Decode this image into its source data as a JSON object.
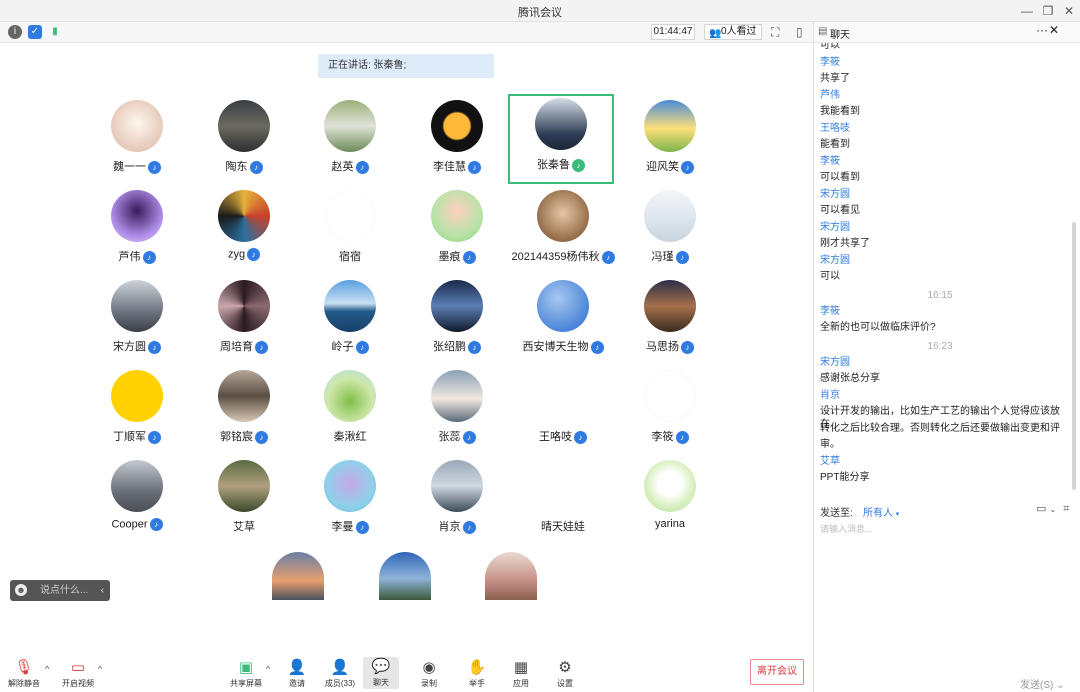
{
  "window": {
    "title": "腾讯会议"
  },
  "topbar": {
    "timer": "01:44:47",
    "viewers": "0人看过"
  },
  "speaking": "正在讲话: 张秦鲁;",
  "participants": [
    {
      "name": "魏一一"
    },
    {
      "name": "陶东"
    },
    {
      "name": "赵英"
    },
    {
      "name": "李佳慧"
    },
    {
      "name": "张秦鲁"
    },
    {
      "name": "迎风笑"
    },
    {
      "name": "芦伟"
    },
    {
      "name": "zyg"
    },
    {
      "name": "宿宿"
    },
    {
      "name": "墨痕"
    },
    {
      "name": "202144359杨伟秋"
    },
    {
      "name": "冯瑾"
    },
    {
      "name": "宋方圆"
    },
    {
      "name": "周培育"
    },
    {
      "name": "岭子"
    },
    {
      "name": "张绍鹏"
    },
    {
      "name": "西安博天生物"
    },
    {
      "name": "马思扬"
    },
    {
      "name": "丁顺军"
    },
    {
      "name": "郭铭宸"
    },
    {
      "name": "秦湫红"
    },
    {
      "name": "张蕊"
    },
    {
      "name": "王咯吱"
    },
    {
      "name": "李筱"
    },
    {
      "name": "Cooper"
    },
    {
      "name": "艾草"
    },
    {
      "name": "李曼"
    },
    {
      "name": "肖京"
    },
    {
      "name": "晴天娃娃"
    },
    {
      "name": "yarina"
    }
  ],
  "saybox": {
    "placeholder": "说点什么..."
  },
  "bottombar": {
    "unmute": "解除静音",
    "video": "开启视频",
    "share": "共享屏幕",
    "invite": "邀请",
    "members": "成员(33)",
    "chat": "聊天",
    "record": "录制",
    "hand": "举手",
    "apps": "应用",
    "settings": "设置",
    "leave": "离开会议"
  },
  "chat": {
    "title": "聊天",
    "messages": [
      {
        "kind": "m",
        "text": "可以"
      },
      {
        "kind": "s",
        "text": "李筱"
      },
      {
        "kind": "m",
        "text": "共享了"
      },
      {
        "kind": "s",
        "text": "芦伟"
      },
      {
        "kind": "m",
        "text": "我能看到"
      },
      {
        "kind": "s",
        "text": "王咯吱"
      },
      {
        "kind": "m",
        "text": "能看到"
      },
      {
        "kind": "s",
        "text": "李筱"
      },
      {
        "kind": "m",
        "text": "可以看到"
      },
      {
        "kind": "s",
        "text": "宋方圆"
      },
      {
        "kind": "m",
        "text": "可以看见"
      },
      {
        "kind": "s",
        "text": "宋方圆"
      },
      {
        "kind": "m",
        "text": "刚才共享了"
      },
      {
        "kind": "s",
        "text": "宋方圆"
      },
      {
        "kind": "m",
        "text": "可以"
      },
      {
        "kind": "time",
        "text": "16:15"
      },
      {
        "kind": "s",
        "text": "李筱"
      },
      {
        "kind": "m",
        "text": "全新的也可以做临床评价?"
      },
      {
        "kind": "time",
        "text": "16:23"
      },
      {
        "kind": "s",
        "text": "宋方圆"
      },
      {
        "kind": "m",
        "text": "感谢张总分享"
      },
      {
        "kind": "s",
        "text": "肖京"
      },
      {
        "kind": "m",
        "text": "设计开发的输出，比如生产工艺的输出个人觉得应该放在"
      },
      {
        "kind": "m",
        "text": "转化之后比较合理。否则转化之后还要做输出变更和评"
      },
      {
        "kind": "m",
        "text": "审。"
      },
      {
        "kind": "s",
        "text": "艾草"
      },
      {
        "kind": "m",
        "text": "PPT能分享"
      }
    ],
    "send_to_label": "发送至:",
    "send_to_value": "所有人",
    "input_placeholder": "请输入消息...",
    "send_label": "发送(S)"
  }
}
